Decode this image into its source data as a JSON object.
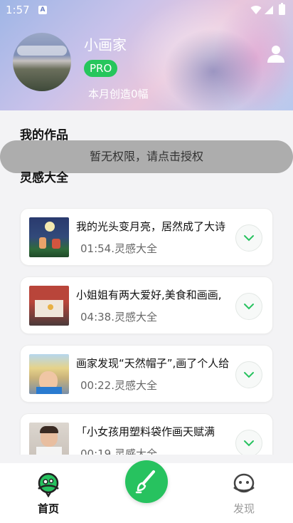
{
  "status_bar": {
    "time": "1:57",
    "app_icon_letter": "A"
  },
  "profile": {
    "username": "小画家",
    "badge": "PRO",
    "created_summary": "本月创造0幅"
  },
  "sections": {
    "my_works": "我的作品",
    "inspiration": "灵感大全"
  },
  "toast": "暂无权限，请点击授权",
  "inspiration_list": [
    {
      "title": "我的光头变月亮，居然成了大诗",
      "meta": "01:54.灵感大全"
    },
    {
      "title": "小姐姐有两大爱好,美食和画画,",
      "meta": "04:38.灵感大全"
    },
    {
      "title": "画家发现“天然帽子”,画了个人给",
      "meta": "00:22.灵感大全"
    },
    {
      "title": "「小女孩用塑料袋作画天赋满",
      "meta": "00:19.灵感大全"
    }
  ],
  "bottom_nav": {
    "home": "首页",
    "discover": "发现"
  },
  "colors": {
    "accent": "#27c25f",
    "pro_badge": "#26c65c",
    "background": "#f3f3f5"
  },
  "icons": {
    "user": "user-icon",
    "expand": "chevron-down-icon",
    "home": "home-planet-icon",
    "create": "paintbrush-icon",
    "discover": "discover-planet-icon"
  }
}
